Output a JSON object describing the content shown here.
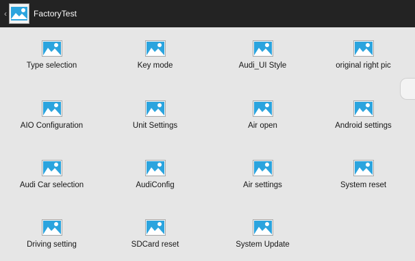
{
  "header": {
    "back_icon": "chevron-left-icon",
    "app_icon": "image-placeholder-icon",
    "title": "FactoryTest"
  },
  "colors": {
    "topbar": "#232323",
    "background": "#e6e6e6",
    "icon_sky": "#2ba4de",
    "icon_frame": "#9a9a9a"
  },
  "grid": {
    "items": [
      {
        "label": "Type selection",
        "icon": "image-placeholder-icon"
      },
      {
        "label": "Key mode",
        "icon": "image-placeholder-icon"
      },
      {
        "label": "Audi_UI Style",
        "icon": "image-placeholder-icon"
      },
      {
        "label": "original right pic",
        "icon": "image-placeholder-icon"
      },
      {
        "label": "AIO Configuration",
        "icon": "image-placeholder-icon"
      },
      {
        "label": "Unit Settings",
        "icon": "image-placeholder-icon"
      },
      {
        "label": "Air open",
        "icon": "image-placeholder-icon"
      },
      {
        "label": "Android settings",
        "icon": "image-placeholder-icon"
      },
      {
        "label": "Audi Car selection",
        "icon": "image-placeholder-icon"
      },
      {
        "label": "AudiConfig",
        "icon": "image-placeholder-icon"
      },
      {
        "label": "Air settings",
        "icon": "image-placeholder-icon"
      },
      {
        "label": "System reset",
        "icon": "image-placeholder-icon"
      },
      {
        "label": "Driving setting",
        "icon": "image-placeholder-icon"
      },
      {
        "label": "SDCard reset",
        "icon": "image-placeholder-icon"
      },
      {
        "label": "System Update",
        "icon": "image-placeholder-icon"
      }
    ]
  }
}
